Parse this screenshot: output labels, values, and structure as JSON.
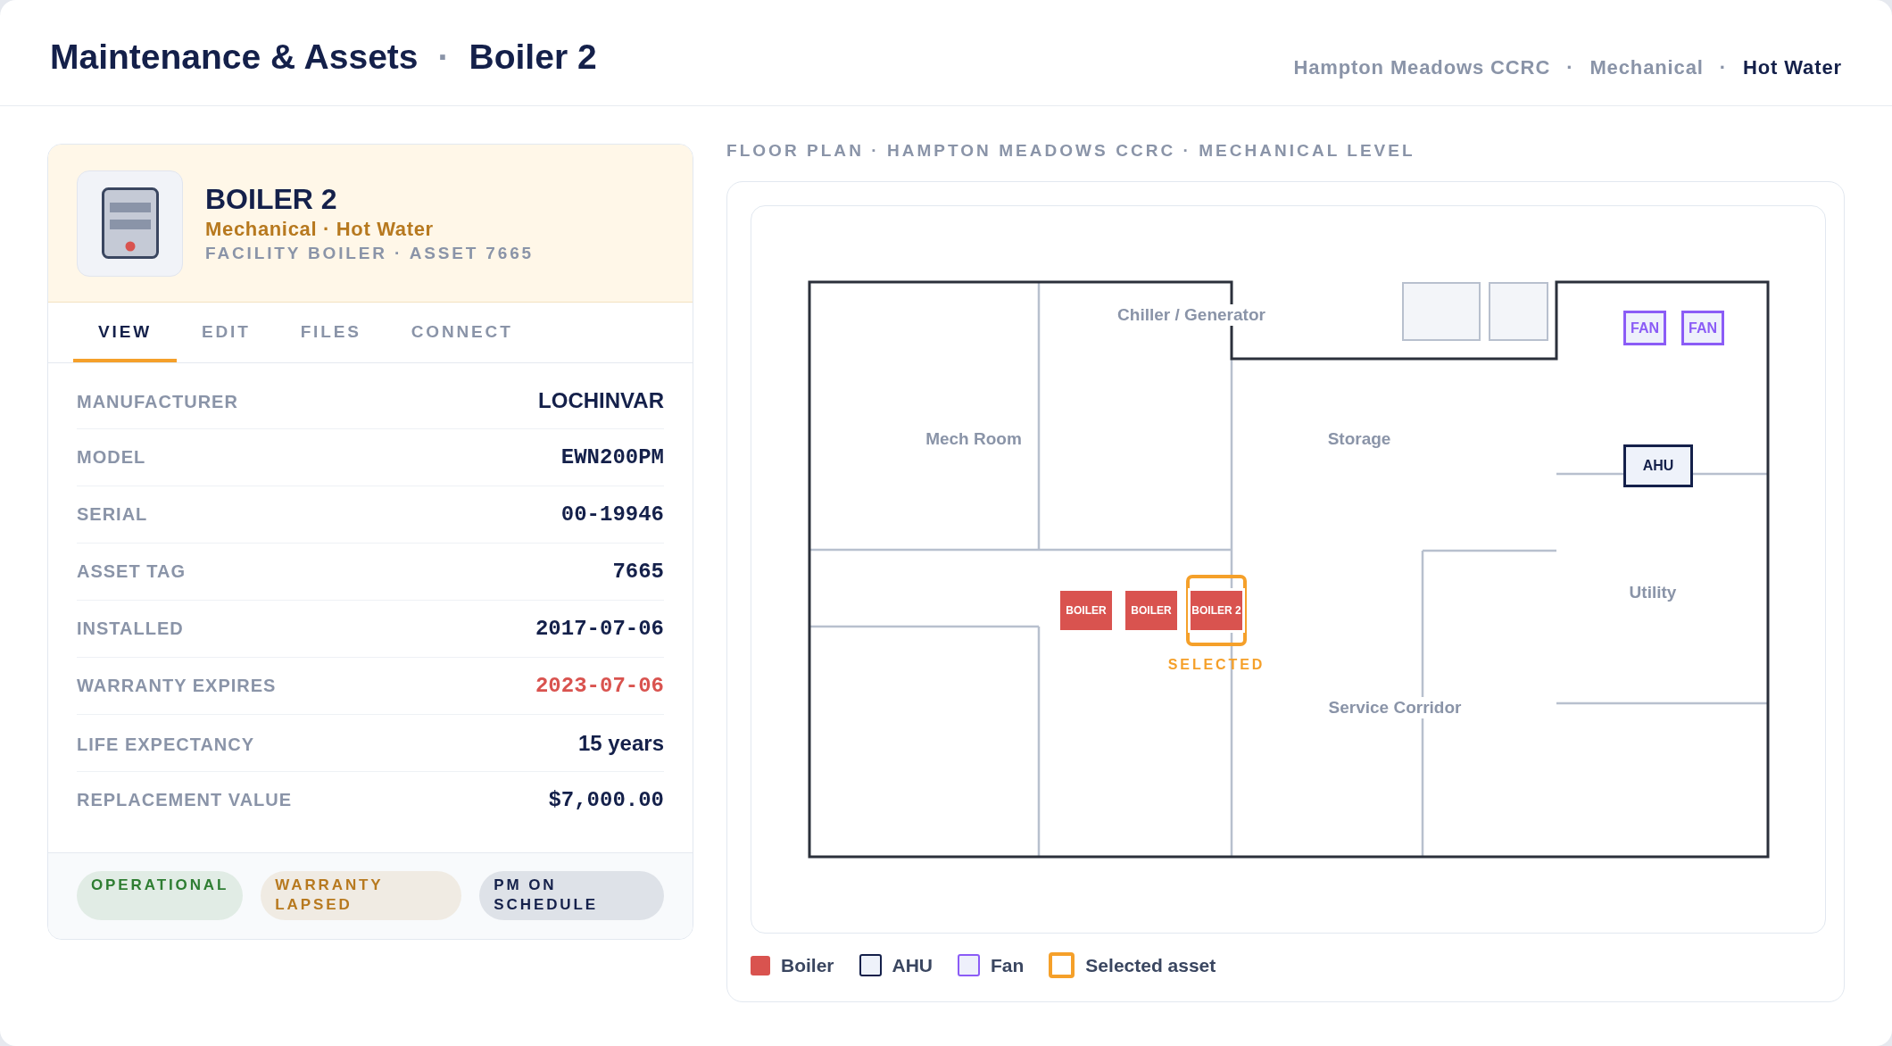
{
  "header": {
    "title": "Maintenance & Assets",
    "separator": "·",
    "subtitle": "Boiler 2",
    "breadcrumb": [
      {
        "kind": "crumb",
        "label": "Hampton Meadows CCRC",
        "current": false
      },
      {
        "kind": "separator",
        "label": "·"
      },
      {
        "kind": "crumb",
        "label": "Mechanical",
        "current": false
      },
      {
        "kind": "separator",
        "label": "·"
      },
      {
        "kind": "crumb",
        "label": "Hot Water",
        "current": true
      }
    ]
  },
  "asset": {
    "name": "BOILER 2",
    "category": "Mechanical · Hot Water",
    "code": "FACILITY BOILER · ASSET 7665",
    "tabs": [
      {
        "label": "VIEW",
        "selected": true
      },
      {
        "label": "EDIT",
        "selected": false
      },
      {
        "label": "FILES",
        "selected": false
      },
      {
        "label": "CONNECT",
        "selected": false
      }
    ],
    "details": [
      {
        "label": "MANUFACTURER",
        "value": "LOCHINVAR",
        "kind": "text",
        "flagged": false
      },
      {
        "label": "MODEL",
        "value": "EWN200PM",
        "kind": "code",
        "flagged": false
      },
      {
        "label": "SERIAL",
        "value": "00-19946",
        "kind": "code",
        "flagged": false
      },
      {
        "label": "ASSET TAG",
        "value": "7665",
        "kind": "code",
        "flagged": false
      },
      {
        "label": "INSTALLED",
        "value": "2017-07-06",
        "kind": "code",
        "flagged": false
      },
      {
        "label": "WARRANTY EXPIRES",
        "value": "2023-07-06",
        "kind": "code",
        "flagged": true
      },
      {
        "label": "LIFE EXPECTANCY",
        "value": "15 years",
        "kind": "text",
        "flagged": false
      },
      {
        "label": "REPLACEMENT VALUE",
        "value": "$7,000.00",
        "kind": "code",
        "flagged": false
      }
    ],
    "badges": [
      {
        "label": "OPERATIONAL",
        "color": "#2e7d32"
      },
      {
        "label": "WARRANTY LAPSED",
        "color": "#b7791f"
      },
      {
        "label": "PM ON SCHEDULE",
        "color": "#14204a"
      }
    ]
  },
  "floor_plan": {
    "title": "FLOOR PLAN · HAMPTON MEADOWS CCRC · MECHANICAL LEVEL",
    "rooms": [
      {
        "name": "Chiller / Generator"
      },
      {
        "name": "Mech Room"
      },
      {
        "name": "Storage"
      },
      {
        "name": "Utility"
      },
      {
        "name": "Service Corridor"
      }
    ],
    "equipment": [
      {
        "kind": "fan",
        "label": "FAN",
        "selected": false
      },
      {
        "kind": "fan",
        "label": "FAN",
        "selected": false
      },
      {
        "kind": "ahu",
        "label": "AHU",
        "selected": false
      },
      {
        "kind": "boiler",
        "label": "BOILER",
        "selected": false
      },
      {
        "kind": "boiler",
        "label": "BOILER",
        "selected": false
      },
      {
        "kind": "boiler",
        "label": "BOILER 2",
        "selected": true
      }
    ],
    "selected_label": "SELECTED",
    "legend": [
      {
        "kind": "boiler",
        "label": "Boiler"
      },
      {
        "kind": "ahu",
        "label": "AHU"
      },
      {
        "kind": "fan",
        "label": "Fan"
      },
      {
        "kind": "selected",
        "label": "Selected asset"
      }
    ]
  }
}
